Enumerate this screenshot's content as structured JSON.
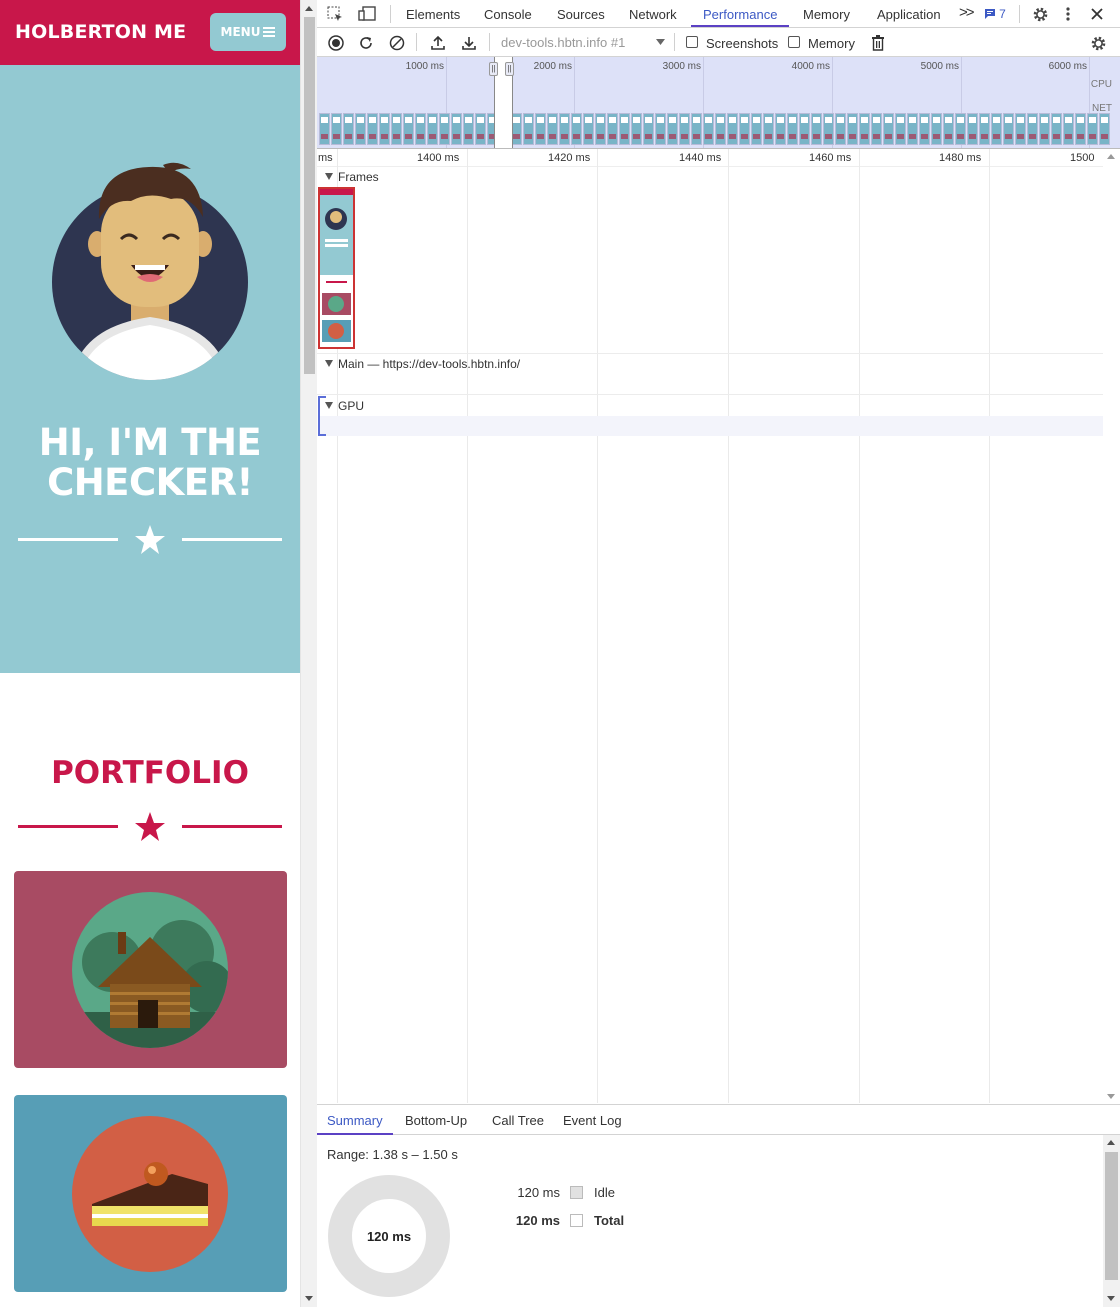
{
  "site": {
    "logo": "HOLBERTON ME",
    "menu_label": "MENU",
    "hero_title_line1": "HI, I'M THE",
    "hero_title_line2": "CHECKER!",
    "portfolio_title": "PORTFOLIO",
    "colors": {
      "brand": "#c8174a",
      "hero": "#93c9d2",
      "card1": "#a84b63",
      "card2": "#579eb6"
    }
  },
  "devtools": {
    "tabs": [
      "Elements",
      "Console",
      "Sources",
      "Network",
      "Performance",
      "Memory",
      "Application"
    ],
    "active_tab": "Performance",
    "issues_count": "7",
    "toolbar": {
      "target": "dev-tools.hbtn.info #1",
      "screenshots_label": "Screenshots",
      "memory_label": "Memory"
    },
    "overview": {
      "ticks": [
        "1000 ms",
        "2000 ms",
        "3000 ms",
        "4000 ms",
        "5000 ms",
        "6000 ms"
      ],
      "cpu_label": "CPU",
      "net_label": "NET"
    },
    "ruler": [
      "ms",
      "1400 ms",
      "1420 ms",
      "1440 ms",
      "1460 ms",
      "1480 ms",
      "1500"
    ],
    "tracks": {
      "frames": "Frames",
      "main": "Main — https://dev-tools.hbtn.info/",
      "gpu": "GPU"
    },
    "bottom_tabs": [
      "Summary",
      "Bottom-Up",
      "Call Tree",
      "Event Log"
    ],
    "summary": {
      "range": "Range: 1.38 s – 1.50 s",
      "donut_label": "120 ms",
      "rows": [
        {
          "value": "120 ms",
          "name": "Idle"
        },
        {
          "value": "120 ms",
          "name": "Total"
        }
      ]
    }
  }
}
